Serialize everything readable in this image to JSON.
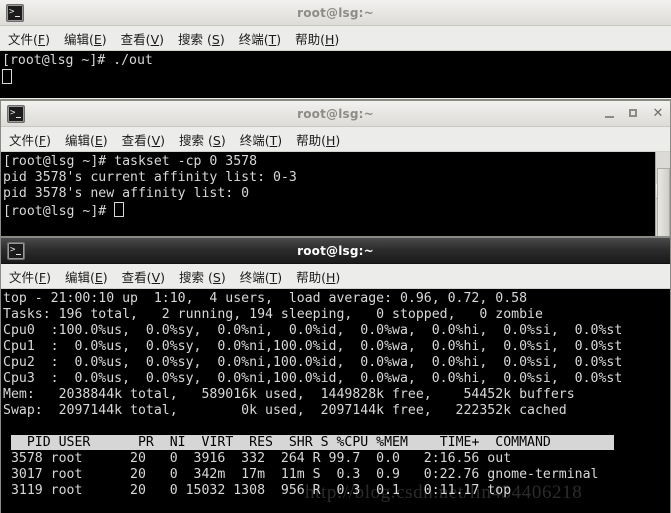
{
  "menu": {
    "items": [
      {
        "label": "文件(",
        "key": "F",
        "tail": ")"
      },
      {
        "label": "编辑(",
        "key": "E",
        "tail": ")"
      },
      {
        "label": "查看(",
        "key": "V",
        "tail": ")"
      },
      {
        "label": "搜索 (",
        "key": "S",
        "tail": ")"
      },
      {
        "label": "终端(",
        "key": "T",
        "tail": ")"
      },
      {
        "label": "帮助(",
        "key": "H",
        "tail": ")"
      }
    ]
  },
  "window1": {
    "title": "root@lsg:~",
    "icon": "terminal-icon",
    "lines": [
      "[root@lsg ~]# ./out"
    ]
  },
  "window2": {
    "title": "root@lsg:~",
    "icon": "terminal-icon",
    "buttons": {
      "minimize": "_",
      "maximize": "□",
      "close": "✕"
    },
    "lines": [
      "[root@lsg ~]# taskset -cp 0 3578",
      "pid 3578's current affinity list: 0-3",
      "pid 3578's new affinity list: 0",
      "[root@lsg ~]# "
    ]
  },
  "window3": {
    "title": "root@lsg:~",
    "icon": "terminal-icon",
    "summary": [
      "top - 21:00:10 up  1:10,  4 users,  load average: 0.96, 0.72, 0.58",
      "Tasks: 196 total,   2 running, 194 sleeping,   0 stopped,   0 zombie",
      "Cpu0  :100.0%us,  0.0%sy,  0.0%ni,  0.0%id,  0.0%wa,  0.0%hi,  0.0%si,  0.0%st",
      "Cpu1  :  0.0%us,  0.0%sy,  0.0%ni,100.0%id,  0.0%wa,  0.0%hi,  0.0%si,  0.0%st",
      "Cpu2  :  0.0%us,  0.0%sy,  0.0%ni,100.0%id,  0.0%wa,  0.0%hi,  0.0%si,  0.0%st",
      "Cpu3  :  0.0%us,  0.0%sy,  0.0%ni,100.0%id,  0.0%wa,  0.0%hi,  0.0%si,  0.0%st",
      "Mem:   2038844k total,   589016k used,  1449828k free,    54452k buffers",
      "Swap:  2097144k total,        0k used,  2097144k free,   222352k cached"
    ],
    "blank_line": "",
    "table_header": "  PID USER      PR  NI  VIRT  RES  SHR S %CPU %MEM    TIME+  COMMAND        ",
    "rows": [
      " 3578 root      20   0  3916  332  264 R 99.7  0.0   2:16.56 out",
      " 3017 root      20   0  342m  17m  11m S  0.3  0.9   0:22.76 gnome-terminal",
      " 3119 root      20   0 15032 1308  956 R  0.3  0.1   0:11.17 top"
    ]
  },
  "watermark": {
    "text": "http://blog.csdn.net/lin434406218"
  }
}
